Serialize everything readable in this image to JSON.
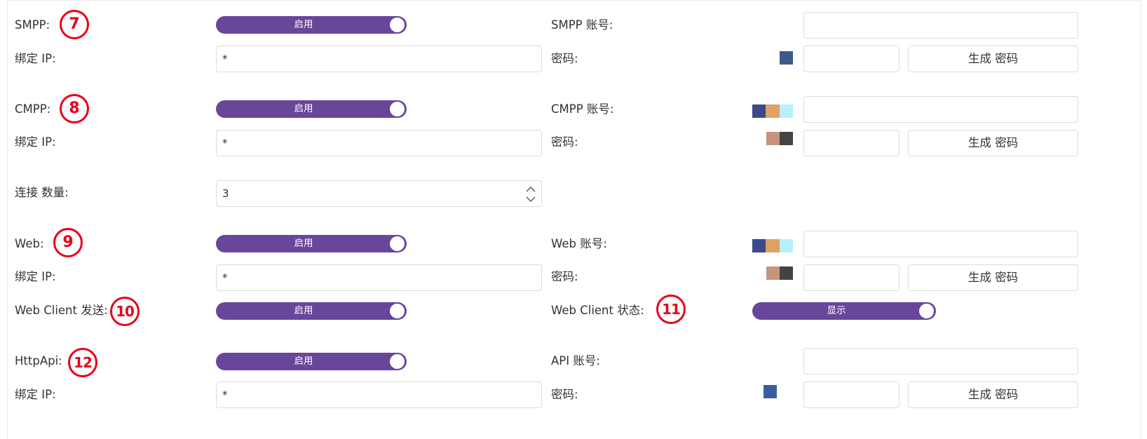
{
  "smpp": {
    "label": "SMPP:",
    "badge": "7",
    "toggle": "启用",
    "bind_ip_label": "绑定 IP:",
    "bind_ip_value": "*",
    "account_label": "SMPP 账号:",
    "password_label": "密码:",
    "generate_password": "生成 密码"
  },
  "cmpp": {
    "label": "CMPP:",
    "badge": "8",
    "toggle": "启用",
    "bind_ip_label": "绑定 IP:",
    "bind_ip_value": "*",
    "account_label": "CMPP 账号:",
    "password_label": "密码:",
    "generate_password": "生成 密码"
  },
  "connection": {
    "label": "连接 数量:",
    "value": "3"
  },
  "web": {
    "label": "Web:",
    "badge": "9",
    "toggle": "启用",
    "bind_ip_label": "绑定 IP:",
    "bind_ip_value": "*",
    "account_label": "Web 账号:",
    "password_label": "密码:",
    "generate_password": "生成 密码"
  },
  "web_client": {
    "send_label": "Web Client 发送:",
    "send_badge": "10",
    "send_toggle": "启用",
    "status_label": "Web Client 状态:",
    "status_badge": "11",
    "status_toggle": "显示"
  },
  "httpapi": {
    "label": "HttpApi:",
    "badge": "12",
    "toggle": "启用",
    "bind_ip_label": "绑定 IP:",
    "bind_ip_value": "*",
    "account_label": "API 账号:",
    "password_label": "密码:",
    "generate_password": "生成 密码"
  },
  "colors": {
    "toggle_purple": "#68469a",
    "badge_red": "#e8001c",
    "border": "#dcdcdc",
    "text": "#333333"
  }
}
